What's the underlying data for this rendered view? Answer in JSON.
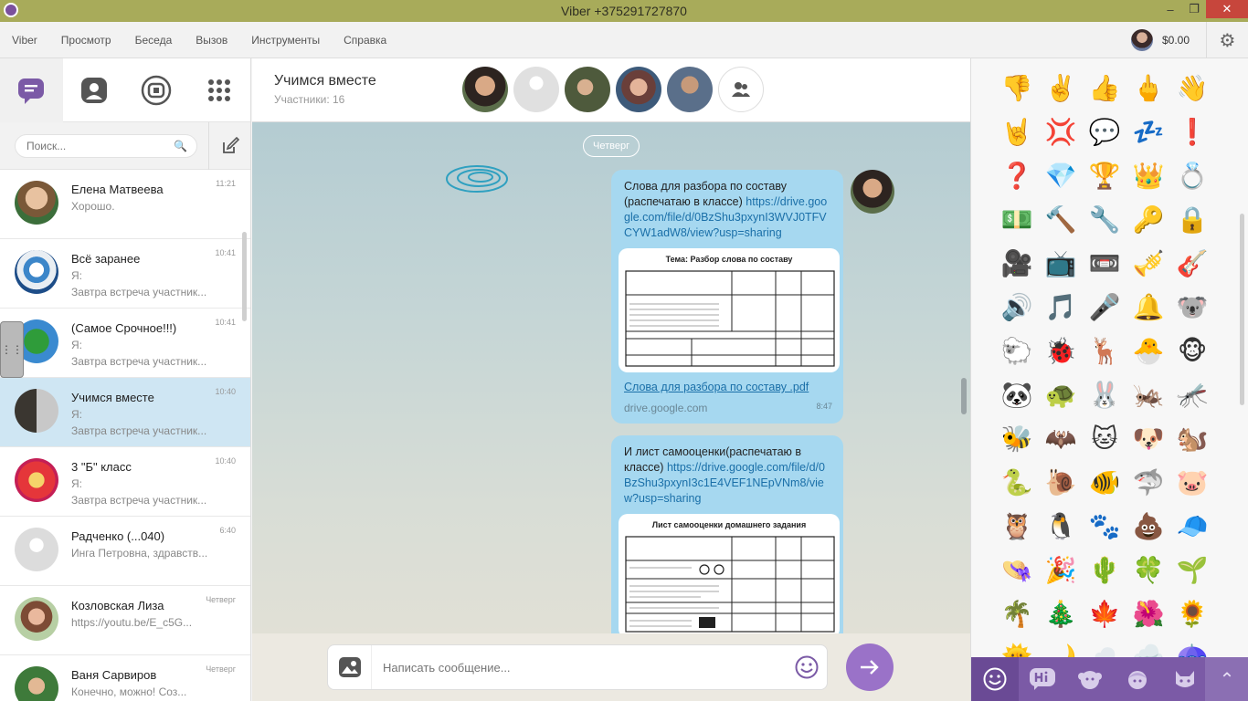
{
  "window": {
    "title": "Viber +375291727870"
  },
  "menu": {
    "items": [
      "Viber",
      "Просмотр",
      "Беседа",
      "Вызов",
      "Инструменты",
      "Справка"
    ],
    "balance": "$0.00"
  },
  "left": {
    "search_placeholder": "Поиск...",
    "chats": [
      {
        "name": "Елена Матвеева",
        "line1": "Хорошо.",
        "line2": "",
        "time": "11:21"
      },
      {
        "name": "Всё заранее",
        "line1": "Я:",
        "line2": "Завтра встреча участник...",
        "time": "10:41"
      },
      {
        "name": "(Самое Срочное!!!)",
        "line1": "Я:",
        "line2": "Завтра встреча участник...",
        "time": "10:41"
      },
      {
        "name": "Учимся вместе",
        "line1": "Я:",
        "line2": "Завтра встреча участник...",
        "time": "10:40"
      },
      {
        "name": "3 \"Б\" класс",
        "line1": "Я:",
        "line2": "Завтра встреча участник...",
        "time": "10:40"
      },
      {
        "name": "Радченко (...040)",
        "line1": "Инга Петровна, здравств...",
        "line2": "",
        "time": "6:40"
      },
      {
        "name": "Козловская Лиза",
        "line1": "https://youtu.be/E_c5G...",
        "line2": "",
        "time": "Четверг"
      },
      {
        "name": "Ваня Сарвиров",
        "line1": "Конечно, можно! Соз...",
        "line2": "",
        "time": "Четверг"
      }
    ]
  },
  "conversation": {
    "title": "Учимся вместе",
    "subtitle": "Участники: 16",
    "day": "Четверг",
    "messages": [
      {
        "text": "Слова для разбора по составу (распечатаю в классе) ",
        "link": "https://drive.google.com/file/d/0BzShu3pxynI3WVJ0TFVCYW1adW8/view?usp=sharing",
        "doc_heading": "Тема: Разбор слова по составу",
        "doc_name": "Слова для разбора по составу .pdf",
        "domain": "drive.google.com",
        "time": "8:47"
      },
      {
        "text": "И лист самооценки(распечатаю в классе) ",
        "link": "https://drive.google.com/file/d/0BzShu3pxynI3c1E4VEF1NEpVNm8/view?usp=sharing",
        "doc_heading": "Лист самооценки домашнего задания"
      }
    ],
    "input_placeholder": "Написать сообщение..."
  },
  "emoji": {
    "items": [
      "👎",
      "✌️",
      "👍",
      "🖕",
      "👋",
      "🤘",
      "💢",
      "💬",
      "💤",
      "❗",
      "❓",
      "💎",
      "🏆",
      "👑",
      "💍",
      "💵",
      "🔨",
      "🔧",
      "🔑",
      "🔒",
      "🎥",
      "📺",
      "📼",
      "🎺",
      "🎸",
      "🔊",
      "🎵",
      "🎤",
      "🔔",
      "🐨",
      "🐑",
      "🐞",
      "🦌",
      "🐣",
      "🐵",
      "🐼",
      "🐢",
      "🐰",
      "🦗",
      "🦟",
      "🐝",
      "🦇",
      "🐱",
      "🐶",
      "🐿️",
      "🐍",
      "🐌",
      "🐠",
      "🦈",
      "🐷",
      "🦉",
      "🐧",
      "🐾",
      "💩",
      "🧢",
      "👒",
      "🎉",
      "🌵",
      "🍀",
      "🌱",
      "🌴",
      "🎄",
      "🍁",
      "🌺",
      "🌻",
      "🌞",
      "🌙",
      "☁️",
      "🌧️",
      "☂️"
    ]
  },
  "colors": {
    "accent": "#7b5aa6",
    "bubble": "#a6d8f0",
    "titlebar": "#a8ab5a"
  }
}
